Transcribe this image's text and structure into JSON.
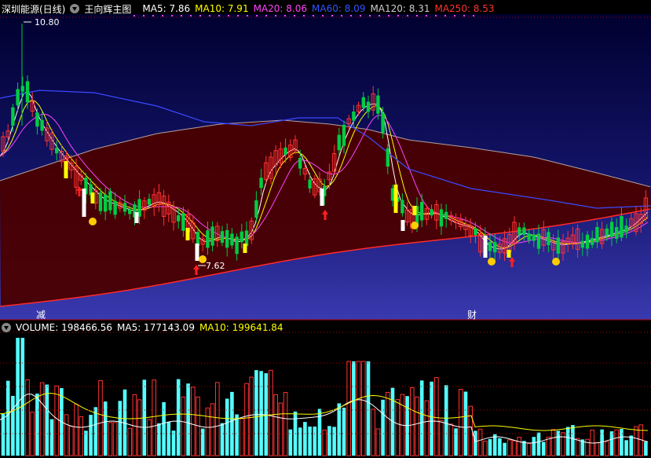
{
  "header": {
    "stock_name": "深圳能源(日线)",
    "indicator_name": "王向辉主图",
    "ma_items": [
      {
        "label": "MA5: 7.86",
        "color": "#ffffff"
      },
      {
        "label": "MA10: 7.91",
        "color": "#ffff00"
      },
      {
        "label": "MA20: 8.06",
        "color": "#ff44ff"
      },
      {
        "label": "MA60: 8.09",
        "color": "#3355ff"
      },
      {
        "label": "MA120: 8.31",
        "color": "#cccccc"
      },
      {
        "label": "MA250: 8.53",
        "color": "#ff3333"
      }
    ]
  },
  "price_panel": {
    "high_label": "10.80",
    "low_label": "7.62",
    "marker_left": "减",
    "marker_right": "财"
  },
  "volume_header": {
    "items": [
      {
        "label": "VOLUME: 198466.56",
        "color": "#ffffff"
      },
      {
        "label": "MA5: 177143.09",
        "color": "#ffffff"
      },
      {
        "label": "MA10: 199641.84",
        "color": "#ffff00"
      }
    ]
  },
  "colors": {
    "up": "#ff3232",
    "down": "#54ffff",
    "candle_up": "#ff3232",
    "candle_down": "#00cc44",
    "band_fill": "#4a0000",
    "yellow_candle": "#ffff00",
    "white_candle": "#ffffff",
    "dot": "#ffcc00"
  }
}
